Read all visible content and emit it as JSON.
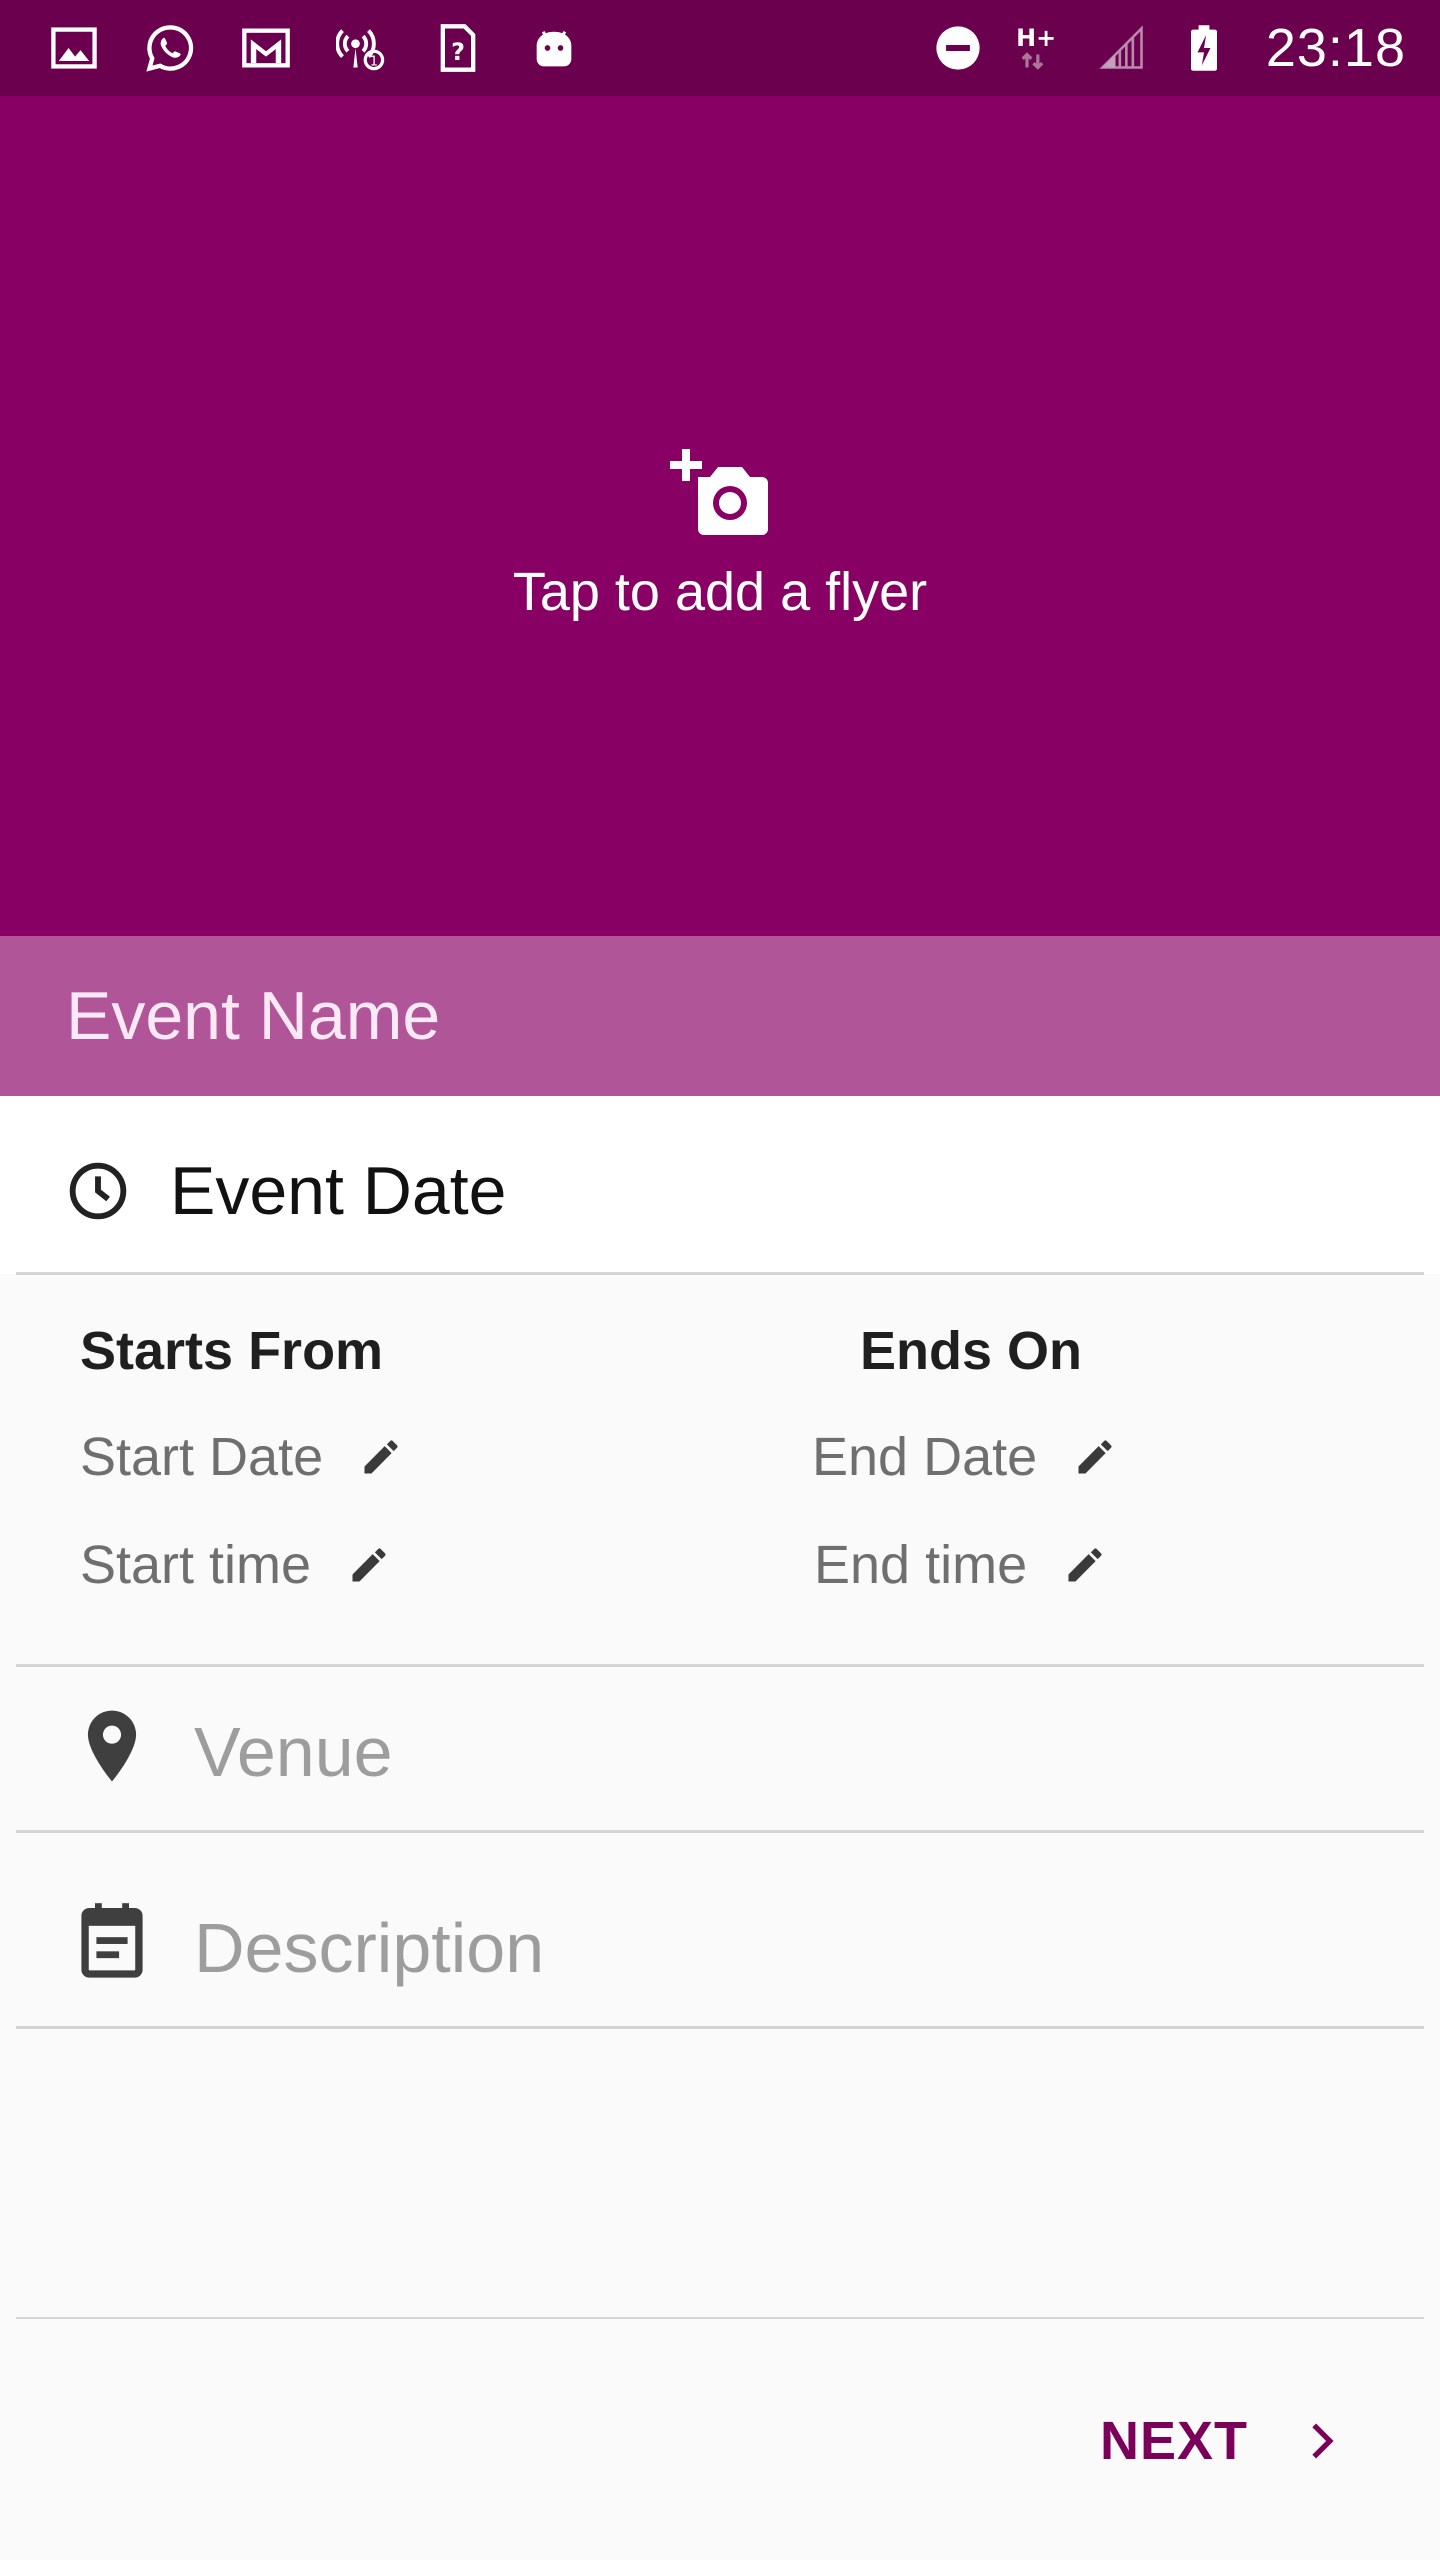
{
  "status_bar": {
    "time": "23:18",
    "left_icons": [
      "gallery-icon",
      "whatsapp-icon",
      "gmail-icon",
      "hotspot-icon",
      "sim-unknown-icon",
      "android-icon"
    ],
    "right_icons": [
      "do-not-disturb-icon",
      "network-hplus-icon",
      "signal-icon",
      "battery-charging-icon"
    ],
    "network_label": "H+"
  },
  "flyer": {
    "label": "Tap to add a flyer",
    "icon": "add-photo-icon"
  },
  "event_name": {
    "placeholder": "Event Name"
  },
  "event_date": {
    "title": "Event Date",
    "starts_from": {
      "heading": "Starts From",
      "date_label": "Start Date",
      "time_label": "Start time"
    },
    "ends_on": {
      "heading": "Ends On",
      "date_label": "End Date",
      "time_label": "End time"
    }
  },
  "venue": {
    "placeholder": "Venue",
    "icon": "location-pin-icon"
  },
  "description": {
    "placeholder": "Description",
    "icon": "event-note-icon"
  },
  "actions": {
    "next_label": "NEXT"
  },
  "colors": {
    "status_bar": "#6a004e",
    "primary": "#880064",
    "event_name_bar": "#b05598",
    "accent_text": "#7b0059"
  }
}
